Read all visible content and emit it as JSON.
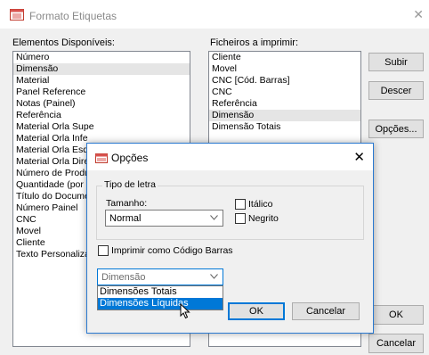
{
  "window": {
    "title": "Formato Etiquetas",
    "close_glyph": "✕"
  },
  "left_panel": {
    "label": "Elementos Disponíveis:",
    "items": [
      "Número",
      "Dimensão",
      "Material",
      "Panel Reference",
      "Notas (Painel)",
      "Referência",
      "Material Orla Supe",
      "Material Orla Infe",
      "Material Orla Esq",
      "Material Orla Dire",
      "Número de Produ",
      "Quantidade (por",
      "Título do Docume",
      "Número Painel",
      "CNC",
      "Movel",
      "Cliente",
      "Texto Personaliza"
    ],
    "selected_index": 1
  },
  "right_panel": {
    "label": "Ficheiros a imprimir:",
    "items": [
      "Cliente",
      "Movel",
      "CNC [Cód. Barras]",
      "CNC",
      "Referência",
      "Dimensão",
      "Dimensão Totais"
    ],
    "selected_index": 5
  },
  "buttons": {
    "up": "Subir",
    "down": "Descer",
    "options": "Opções...",
    "ok": "OK",
    "cancel": "Cancelar"
  },
  "dialog": {
    "title": "Opções",
    "close_glyph": "✕",
    "font_group": "Tipo de letra",
    "size_label": "Tamanho:",
    "size_value": "Normal",
    "italic_label": "Itálico",
    "bold_label": "Negrito",
    "barcode_label": "Imprimir como Código Barras",
    "dimension_combo_value": "Dimensão",
    "dimension_options": [
      "Dimensões Totais",
      "Dimensões Líquidas"
    ],
    "highlighted_option_index": 1,
    "ok": "OK",
    "cancel": "Cancelar"
  },
  "icons": {
    "app": "label-format-icon",
    "dialog": "label-format-icon",
    "combo": "chevron-down-icon",
    "cursor": "mouse-pointer-icon"
  },
  "colors": {
    "selection": "#0078d7",
    "dialog_border": "#2b79d0"
  }
}
